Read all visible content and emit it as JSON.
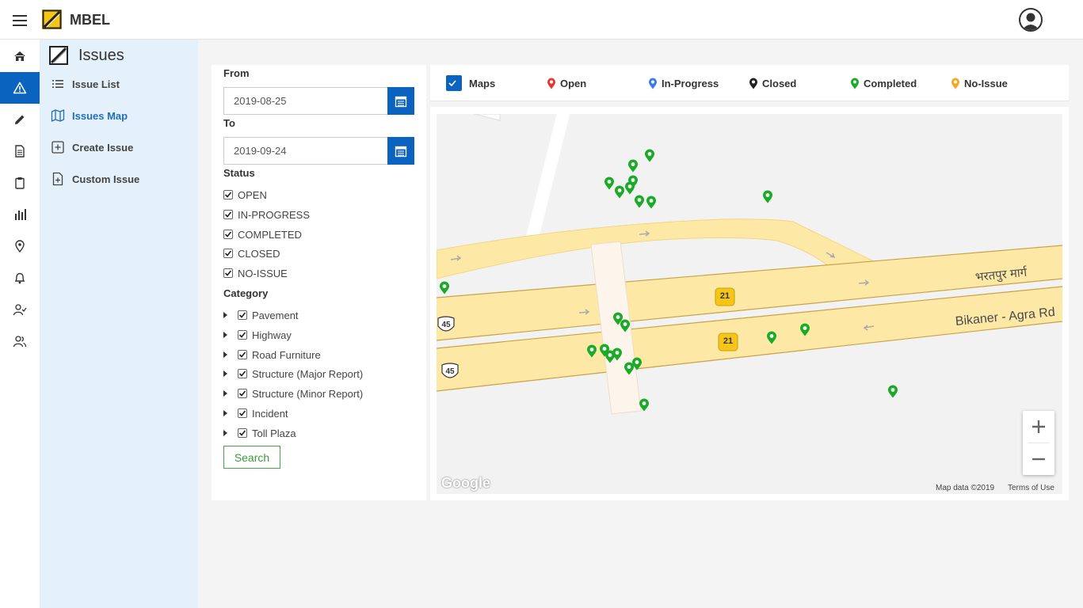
{
  "header": {
    "app_title": "MBEL"
  },
  "rail": {
    "items": [
      {
        "name": "home-icon"
      },
      {
        "name": "warning-icon",
        "active": true
      },
      {
        "name": "pencil-icon"
      },
      {
        "name": "document-icon"
      },
      {
        "name": "clipboard-icon"
      },
      {
        "name": "bar-chart-icon"
      },
      {
        "name": "location-pin-icon"
      },
      {
        "name": "bell-icon"
      },
      {
        "name": "user-check-icon"
      },
      {
        "name": "users-icon"
      }
    ]
  },
  "subnav": {
    "title": "Issues",
    "items": [
      {
        "label": "Issue List",
        "icon": "list-icon",
        "active": false
      },
      {
        "label": "Issues Map",
        "icon": "map-icon",
        "active": true
      },
      {
        "label": "Create Issue",
        "icon": "plus-square-icon",
        "active": false
      },
      {
        "label": "Custom Issue",
        "icon": "file-plus-icon",
        "active": false
      }
    ]
  },
  "filters": {
    "from_label": "From",
    "from_value": "2019-08-25",
    "to_label": "To",
    "to_value": "2019-09-24",
    "status_label": "Status",
    "statuses": [
      "OPEN",
      "IN-PROGRESS",
      "COMPLETED",
      "CLOSED",
      "NO-ISSUE"
    ],
    "category_label": "Category",
    "categories": [
      "Pavement",
      "Highway",
      "Road Furniture",
      "Structure (Major Report)",
      "Structure (Minor Report)",
      "Incident",
      "Toll Plaza"
    ],
    "search_label": "Search"
  },
  "legend": {
    "maps_label": "Maps",
    "items": [
      {
        "label": "Open",
        "color": "#e53935"
      },
      {
        "label": "In-Progress",
        "color": "#3b7be8"
      },
      {
        "label": "Closed",
        "color": "#222222"
      },
      {
        "label": "Completed",
        "color": "#1aab26"
      },
      {
        "label": "No-Issue",
        "color": "#f5a623"
      }
    ]
  },
  "map": {
    "road_label_hindi": "भरतपुर मार्ग",
    "road_label_english": "Bikaner - Agra Rd",
    "shield_21": "21",
    "shield_45": "45",
    "google_label": "Google",
    "attribution": "Map data ©2019",
    "terms": "Terms of Use",
    "zoom_in": "+",
    "zoom_out": "−",
    "marker_status": "Completed",
    "marker_color": "#1aab26",
    "marker_count": 23
  }
}
